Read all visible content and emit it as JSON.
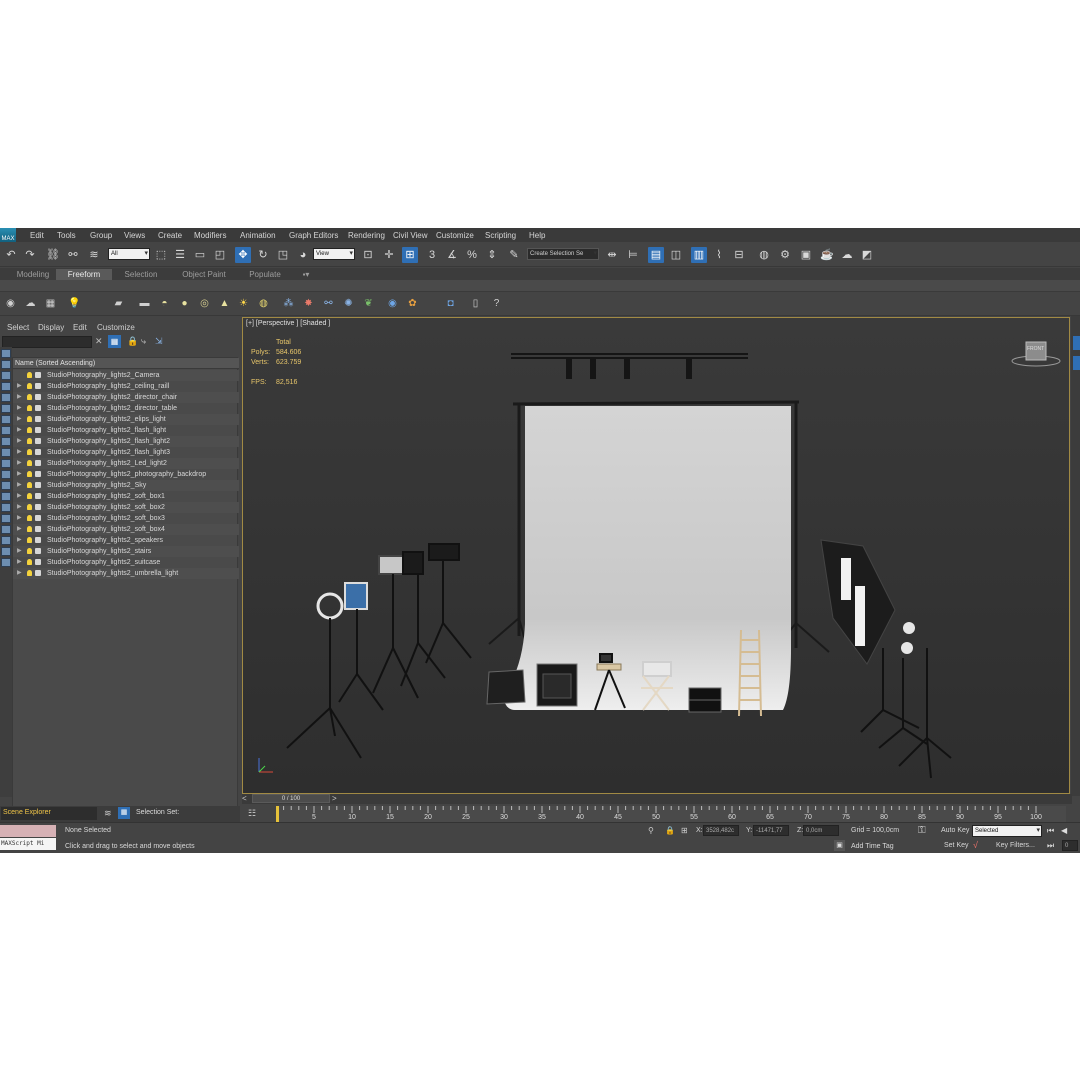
{
  "app": {
    "logo": "MAX"
  },
  "menu": [
    "Edit",
    "Tools",
    "Group",
    "Views",
    "Create",
    "Modifiers",
    "Animation",
    "Graph Editors",
    "Rendering",
    "Civil View",
    "Customize",
    "Scripting",
    "Help"
  ],
  "toolbar": {
    "selection_filter": "All",
    "ref_coord": "View",
    "named_selection": "Create Selection Se"
  },
  "ribbon": {
    "tabs": [
      "Modeling",
      "Freeform",
      "Selection",
      "Object Paint",
      "Populate"
    ],
    "active_tab": "Freeform"
  },
  "explorer": {
    "menu": [
      "Select",
      "Display",
      "Edit",
      "Customize"
    ],
    "column_header": "Name (Sorted Ascending)",
    "items": [
      "StudioPhotography_lights2_Camera",
      "StudioPhotography_lights2_ceiling_raill",
      "StudioPhotography_lights2_director_chair",
      "StudioPhotography_lights2_director_table",
      "StudioPhotography_lights2_elips_light",
      "StudioPhotography_lights2_flash_light",
      "StudioPhotography_lights2_flash_light2",
      "StudioPhotography_lights2_flash_light3",
      "StudioPhotography_lights2_Led_light2",
      "StudioPhotography_lights2_photography_backdrop",
      "StudioPhotography_lights2_Sky",
      "StudioPhotography_lights2_soft_box1",
      "StudioPhotography_lights2_soft_box2",
      "StudioPhotography_lights2_soft_box3",
      "StudioPhotography_lights2_soft_box4",
      "StudioPhotography_lights2_speakers",
      "StudioPhotography_lights2_stairs",
      "StudioPhotography_lights2_suitcase",
      "StudioPhotography_lights2_umbrella_light"
    ],
    "panel_name": "Scene Explorer",
    "selection_set_label": "Selection Set:"
  },
  "viewport": {
    "label": "[+] [Perspective ] [Shaded ]",
    "stats": {
      "total_label": "Total",
      "polys_label": "Polys:",
      "polys_value": "584.606",
      "verts_label": "Verts:",
      "verts_value": "623.759",
      "fps_label": "FPS:",
      "fps_value": "82,516"
    },
    "viewcube_label": "FRONT"
  },
  "timeline": {
    "frame_display": "0 / 100",
    "ticks": [
      "5",
      "10",
      "15",
      "20",
      "25",
      "30",
      "35",
      "40",
      "45",
      "50",
      "55",
      "60",
      "65",
      "70",
      "75",
      "80",
      "85",
      "90",
      "95",
      "100"
    ]
  },
  "status": {
    "maxscript": "MAXScript Mi",
    "selection": "None Selected",
    "prompt": "Click and drag to select and move objects",
    "x_label": "X:",
    "x_value": "3528,482c",
    "y_label": "Y:",
    "y_value": "-11471,77",
    "z_label": "Z:",
    "z_value": "0,0cm",
    "grid": "Grid = 100,0cm",
    "add_time_tag": "Add Time Tag",
    "auto_key": "Auto Key",
    "set_key": "Set Key",
    "key_mode": "Selected",
    "key_filters": "Key Filters...",
    "frame_field": "0"
  }
}
